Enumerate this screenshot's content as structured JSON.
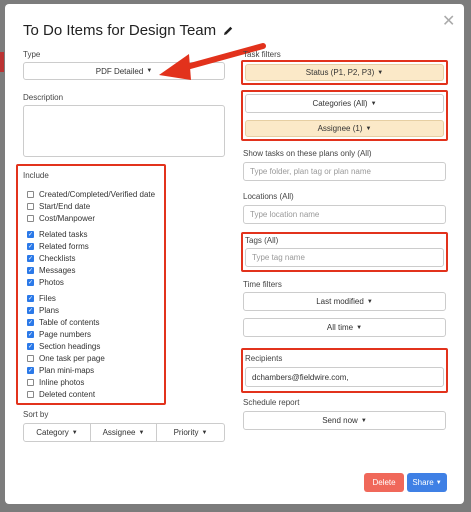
{
  "modal": {
    "title": "To Do Items for Design Team",
    "title_icon": "pencil-icon",
    "close_icon": "close-icon"
  },
  "type": {
    "label": "Type",
    "value": "PDF Detailed"
  },
  "description": {
    "label": "Description",
    "value": ""
  },
  "include": {
    "label": "Include",
    "groups": [
      [
        {
          "label": "Created/Completed/Verified date",
          "checked": false
        },
        {
          "label": "Start/End date",
          "checked": false
        },
        {
          "label": "Cost/Manpower",
          "checked": false
        }
      ],
      [
        {
          "label": "Related tasks",
          "checked": true
        },
        {
          "label": "Related forms",
          "checked": true
        },
        {
          "label": "Checklists",
          "checked": true
        },
        {
          "label": "Messages",
          "checked": true
        },
        {
          "label": "Photos",
          "checked": true
        }
      ],
      [
        {
          "label": "Files",
          "checked": true
        },
        {
          "label": "Plans",
          "checked": true
        },
        {
          "label": "Table of contents",
          "checked": true
        },
        {
          "label": "Page numbers",
          "checked": true
        },
        {
          "label": "Section headings",
          "checked": true
        },
        {
          "label": "One task per page",
          "checked": false
        },
        {
          "label": "Plan mini-maps",
          "checked": true
        },
        {
          "label": "Inline photos",
          "checked": false
        },
        {
          "label": "Deleted content",
          "checked": false
        }
      ]
    ]
  },
  "sort_by": {
    "label": "Sort by",
    "options": [
      "Category",
      "Assignee",
      "Priority"
    ]
  },
  "task_filters": {
    "label": "Task filters",
    "status": "Status (P1, P2, P3)",
    "categories": "Categories (All)",
    "assignee": "Assignee (1)"
  },
  "plans_filter": {
    "label": "Show tasks on these plans only (All)",
    "placeholder": "Type folder, plan tag or plan name"
  },
  "locations": {
    "label": "Locations (All)",
    "placeholder": "Type location name"
  },
  "tags": {
    "label": "Tags (All)",
    "placeholder": "Type tag name"
  },
  "time_filters": {
    "label": "Time filters",
    "last_modified": "Last modified",
    "all_time": "All time"
  },
  "recipients": {
    "label": "Recipients",
    "value": "dchambers@fieldwire.com,"
  },
  "schedule_report": {
    "label": "Schedule report",
    "value": "Send now"
  },
  "footer": {
    "delete": "Delete",
    "share": "Share"
  },
  "colors": {
    "accent": "#3f80e5",
    "danger": "#f0685a",
    "highlight": "#fbe9c8",
    "annotation": "#e2321c"
  }
}
